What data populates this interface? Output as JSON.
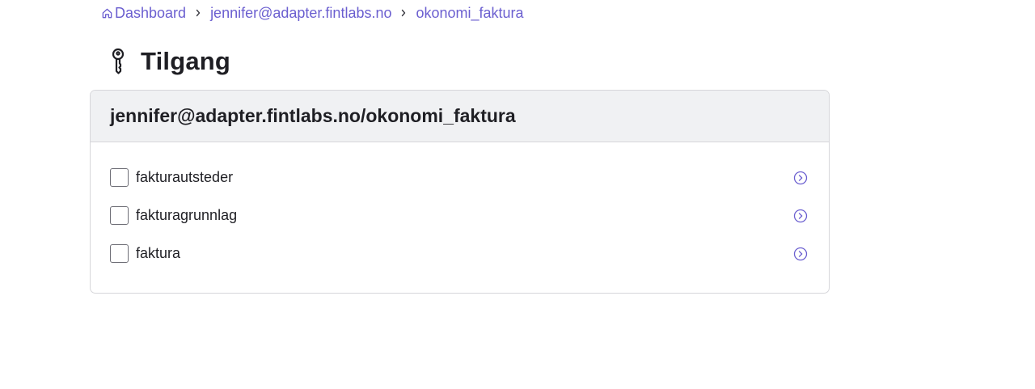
{
  "breadcrumb": {
    "items": [
      {
        "label": "Dashboard",
        "icon": "home-icon"
      },
      {
        "label": "jennifer@adapter.fintlabs.no"
      },
      {
        "label": "okonomi_faktura"
      }
    ],
    "separator_icon": "chevron-right-icon"
  },
  "page": {
    "title": "Tilgang",
    "title_icon": "key-icon"
  },
  "card": {
    "title": "jennifer@adapter.fintlabs.no/okonomi_faktura",
    "items": [
      {
        "label": "fakturautsteder",
        "checked": false,
        "action_icon": "arrow-right-circle-icon"
      },
      {
        "label": "fakturagrunnlag",
        "checked": false,
        "action_icon": "arrow-right-circle-icon"
      },
      {
        "label": "faktura",
        "checked": false,
        "action_icon": "arrow-right-circle-icon"
      }
    ]
  },
  "colors": {
    "link": "#6b5fd0",
    "header_bg": "#f0f1f3",
    "border": "#d6d6da",
    "text": "#1f1f24"
  }
}
